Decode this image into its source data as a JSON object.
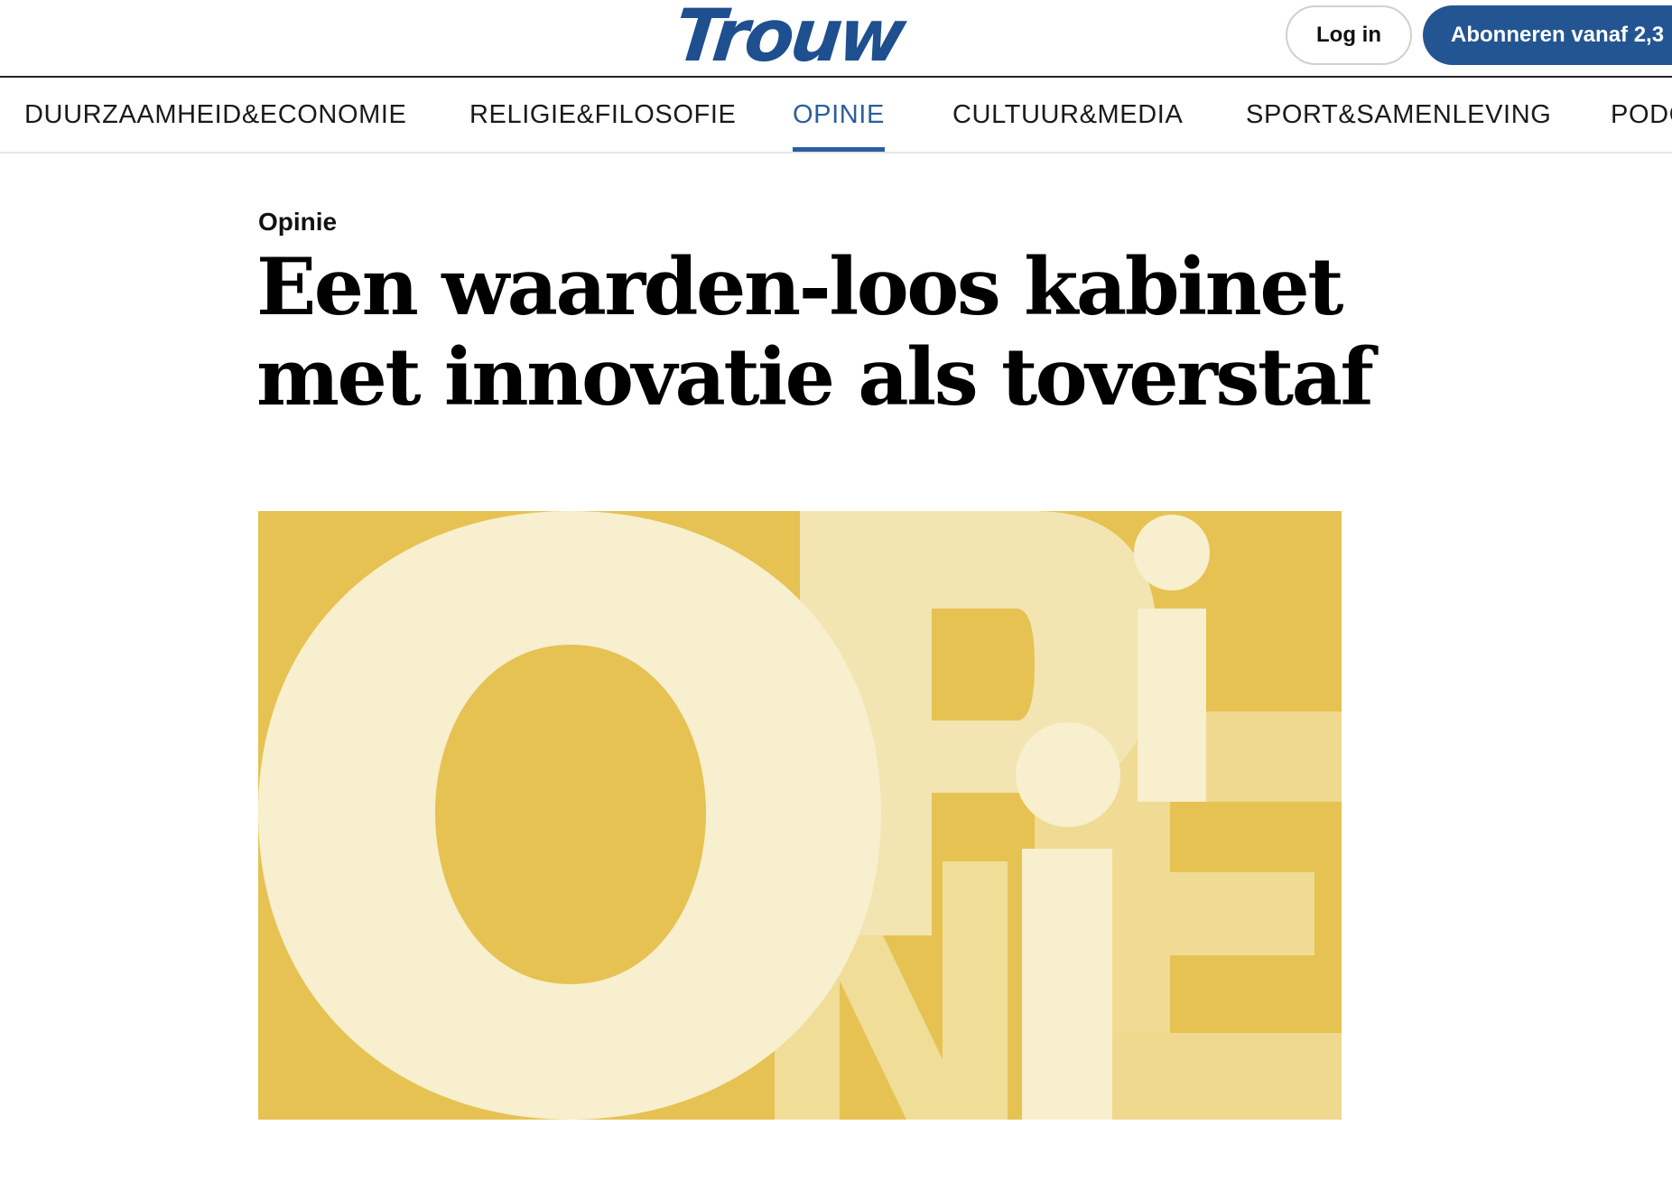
{
  "header": {
    "logo_text": "Trouw",
    "login_label": "Log in",
    "subscribe_label": "Abonneren vanaf 2,3",
    "brand_color": "#245593"
  },
  "nav": {
    "items": [
      {
        "label": "DUURZAAMHEID&ECONOMIE",
        "active": false
      },
      {
        "label": "RELIGIE&FILOSOFIE",
        "active": false
      },
      {
        "label": "OPINIE",
        "active": true
      },
      {
        "label": "CULTUUR&MEDIA",
        "active": false
      },
      {
        "label": "SPORT&SAMENLEVING",
        "active": false
      },
      {
        "label": "PODC",
        "active": false
      }
    ],
    "active_color": "#2b5e9e"
  },
  "article": {
    "kicker": "Opinie",
    "headline_line1": "Een waarden-loos kabinet",
    "headline_line2": "met innovatie als toverstaf",
    "hero_background": "#e6c253",
    "hero_letter_color": "#f7efcd"
  }
}
